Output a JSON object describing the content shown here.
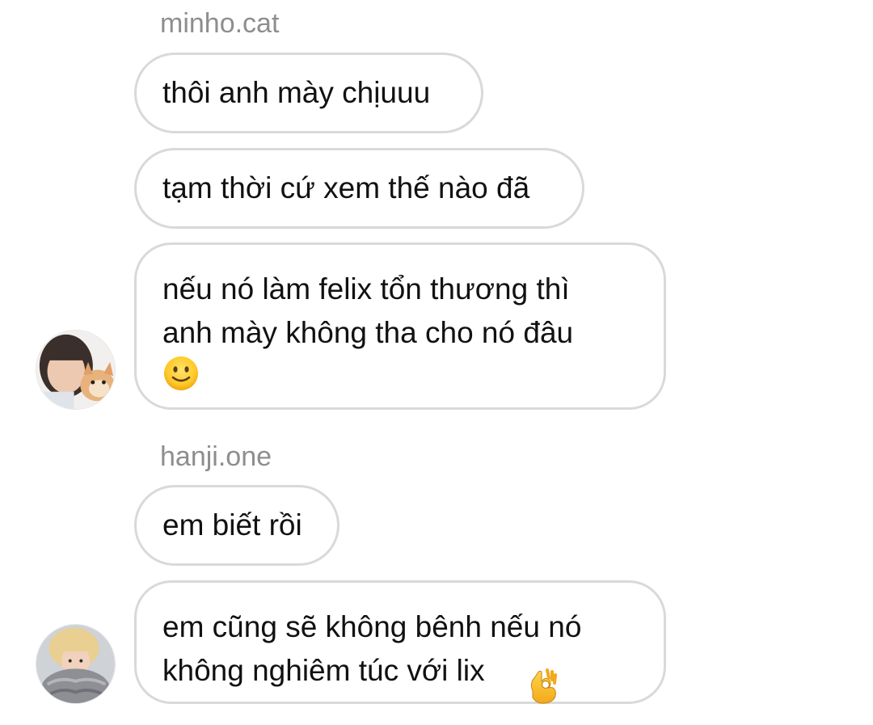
{
  "messages": [
    {
      "username": "minho.cat",
      "bubbles": [
        "thôi anh mày chịuuu",
        "tạm thời cứ xem thế nào đã",
        "nếu nó làm felix tổn thương thì\nanh mày không tha cho nó đâu"
      ],
      "emoji": "slightly-smiling-face-emoji",
      "avatar": "avatar-minho-cat"
    },
    {
      "username": "hanji.one",
      "bubbles": [
        "em biết rồi",
        "em cũng sẽ không bênh nếu nó\nkhông nghiêm túc với lix"
      ],
      "emoji": "ok-hand-emoji",
      "avatar": "avatar-hanji-one"
    }
  ],
  "colors": {
    "bubble_border": "#d9d9d9",
    "username_text": "#8e8e8e",
    "message_text": "#111111",
    "background": "#ffffff"
  }
}
